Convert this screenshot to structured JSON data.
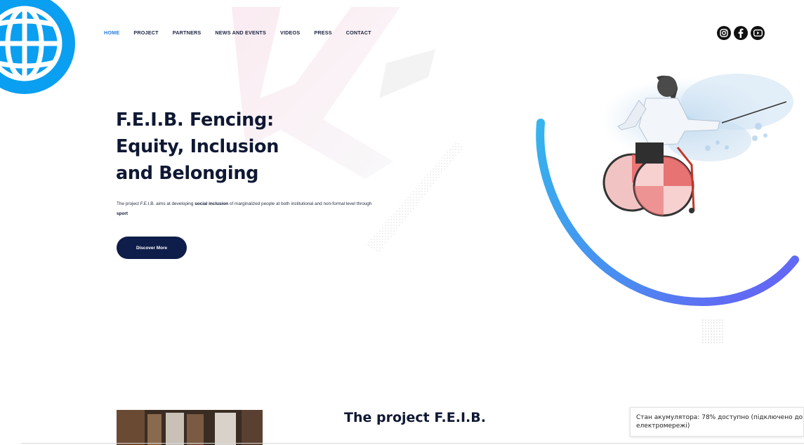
{
  "nav": {
    "items": [
      {
        "label": "HOME",
        "active": true
      },
      {
        "label": "PROJECT"
      },
      {
        "label": "PARTNERS"
      },
      {
        "label": "NEWS AND EVENTS"
      },
      {
        "label": "VIDEOS"
      },
      {
        "label": "PRESS"
      },
      {
        "label": "CONTACT"
      }
    ]
  },
  "social": {
    "icons": [
      "instagram-icon",
      "facebook-icon",
      "youtube-icon"
    ]
  },
  "hero": {
    "title_lines": [
      "F.E.I.B. Fencing:",
      "Equity, Inclusion",
      "and Belonging"
    ],
    "desc_part1": "The project F.E.I.B. aims at developing ",
    "desc_bold1": "social inclusion",
    "desc_part2": " of marginalized people at both institutional and non-formal level through ",
    "desc_bold2": "sport",
    "button_label": "Discover More"
  },
  "project": {
    "title": "The project F.E.I.B."
  },
  "tooltip": {
    "line1": "Стан акумулятора: 78% доступно (підключено до",
    "line2": "електромережі)"
  },
  "colors": {
    "accent": "#2a7de1",
    "navy": "#0f1d4a",
    "globe": "#0a9ff0"
  }
}
